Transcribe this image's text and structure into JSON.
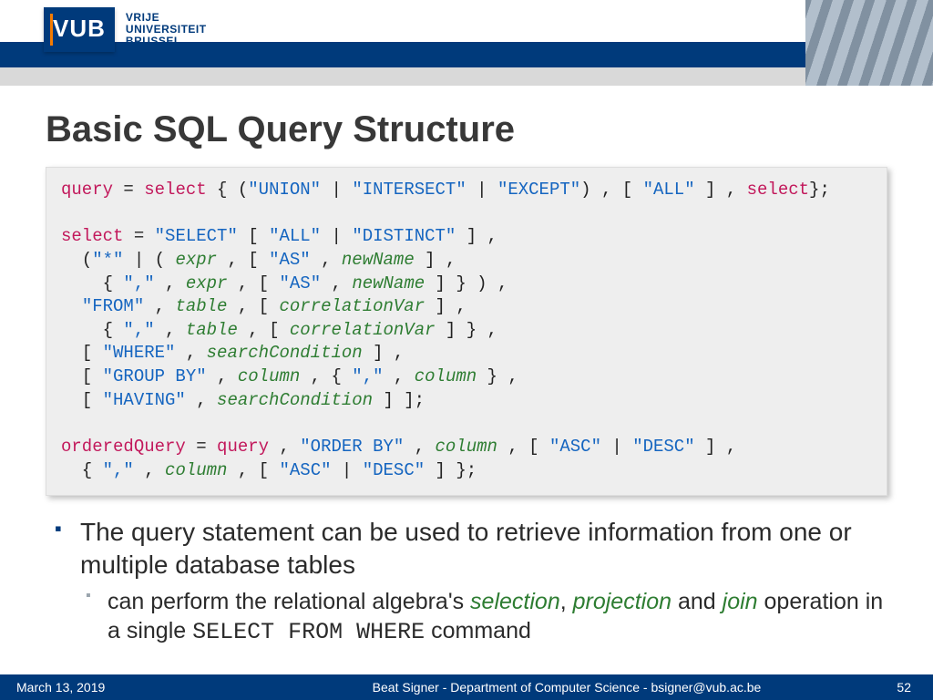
{
  "logo": {
    "abbrev": "VUB",
    "line1": "VRIJE",
    "line2": "UNIVERSITEIT",
    "line3": "BRUSSEL"
  },
  "title": "Basic SQL Query Structure",
  "bullets": {
    "main": "The query statement can be used to retrieve information from one or multiple database tables",
    "sub_prefix": "can perform the relational algebra's ",
    "word_selection": "selection",
    "comma1": ", ",
    "word_projection": "projection",
    "and_txt": " and ",
    "word_join": "join",
    "sub_mid": " operation in a single ",
    "mono_cmd": "SELECT FROM WHERE",
    "sub_suffix": " command"
  },
  "footer": {
    "date": "March 13, 2019",
    "center": "Beat Signer - Department of Computer Science - bsigner@vub.ac.be",
    "page": "52"
  }
}
